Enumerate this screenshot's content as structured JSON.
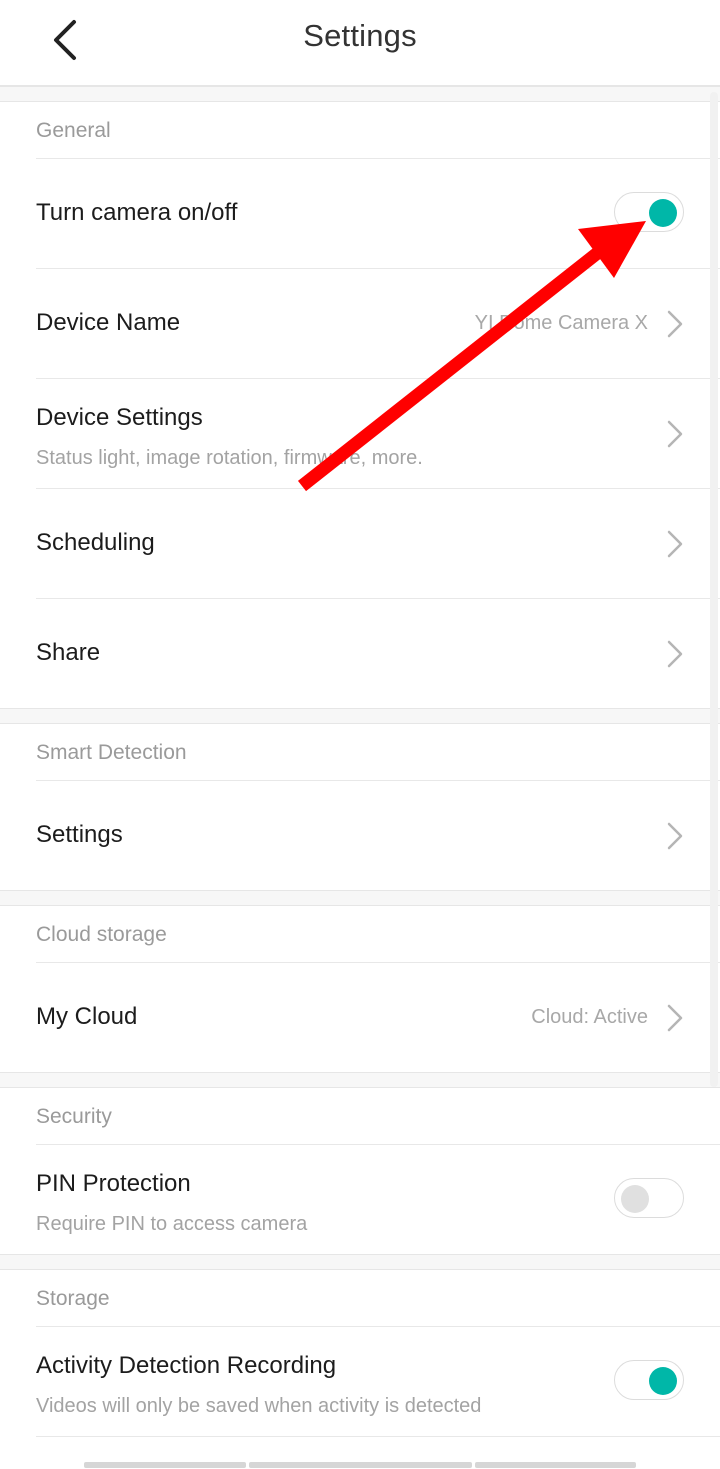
{
  "header": {
    "title": "Settings",
    "back_icon": "chevron-left-icon"
  },
  "accent_color": "#00b7a8",
  "toggle_off_color": "#e0e0e0",
  "annotation_arrow_color": "#ff0000",
  "sections": {
    "general": {
      "label": "General",
      "turn_camera": {
        "title": "Turn camera on/off",
        "toggle": "on"
      },
      "device_name": {
        "title": "Device Name",
        "value": "YI Dome Camera X"
      },
      "device_settings": {
        "title": "Device Settings",
        "subtitle": "Status light, image rotation, firmware, more."
      },
      "scheduling": {
        "title": "Scheduling"
      },
      "share": {
        "title": "Share"
      }
    },
    "smart_detection": {
      "label": "Smart Detection",
      "settings": {
        "title": "Settings"
      }
    },
    "cloud_storage": {
      "label": "Cloud storage",
      "my_cloud": {
        "title": "My Cloud",
        "value": "Cloud: Active"
      }
    },
    "security": {
      "label": "Security",
      "pin_protection": {
        "title": "PIN Protection",
        "subtitle": "Require PIN to access camera",
        "toggle": "off"
      }
    },
    "storage": {
      "label": "Storage",
      "activity_recording": {
        "title": "Activity Detection Recording",
        "subtitle": "Videos will only be saved when activity is detected",
        "toggle": "on"
      }
    }
  }
}
